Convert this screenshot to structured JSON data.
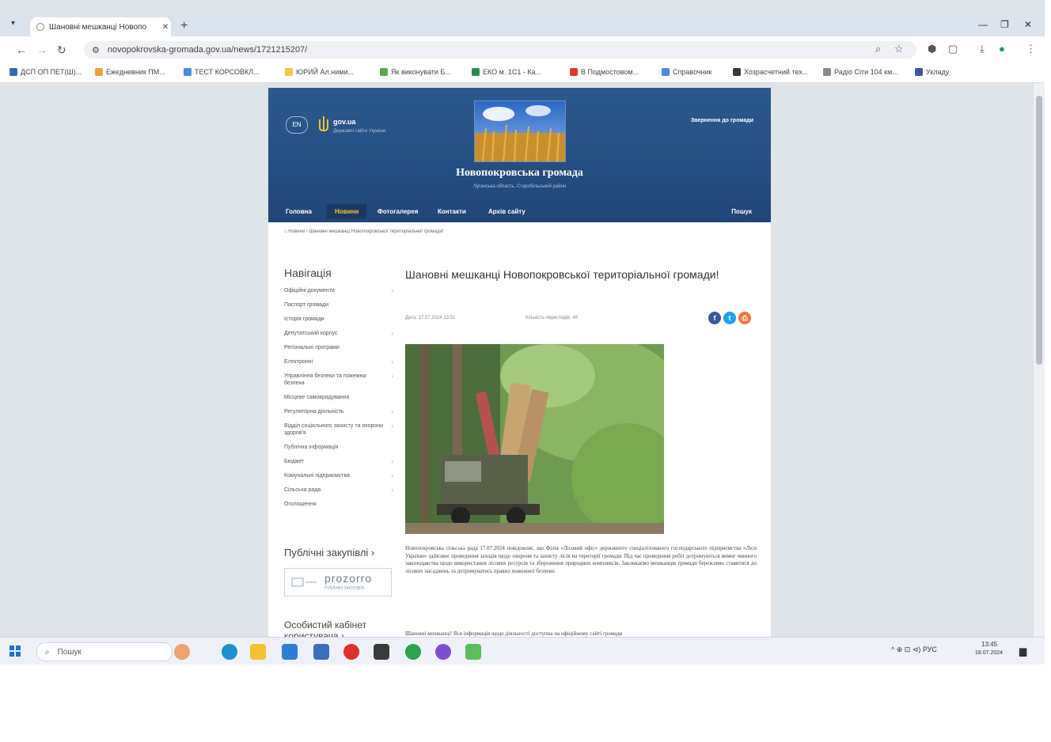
{
  "browser": {
    "tab_title": "Шановні мешканці Новопо",
    "tab_close": "✕",
    "new_tab": "+",
    "address": "novopokrovska-gromada.gov.ua/news/1721215207/",
    "window_min": "—",
    "window_max": "❐",
    "window_close": "✕"
  },
  "bookmarks": [
    {
      "label": "ДСП ОП ПЕТ(Ш)...",
      "color": "#2f6db5"
    },
    {
      "label": "Ежедневник ПМ...",
      "color": "#e8a33a"
    },
    {
      "label": "ТЕСТ КОРСОВКЛ...",
      "color": "#4c8bd6"
    },
    {
      "label": "ЮРИЙ Ал.ними...",
      "color": "#f5c542"
    },
    {
      "label": "Як виконувати Б...",
      "color": "#5aa84a"
    },
    {
      "label": "ЕКО м. 1С1 - Ка...",
      "color": "#2d8a4f"
    },
    {
      "label": "В Подмостовом...",
      "color": "#d83b2f"
    },
    {
      "label": "Справочник",
      "color": "#4c8bd6"
    },
    {
      "label": "Хозрасчетний тех...",
      "color": "#3a3a3a"
    },
    {
      "label": "Радіо Сіти 104 км...",
      "color": "#888888"
    },
    {
      "label": "Укладу",
      "color": "#3b5998"
    }
  ],
  "site": {
    "lang": "EN",
    "gov_name": "gov.ua",
    "gov_sub": "Державні сайти України",
    "header_link": "Звернення до громади",
    "title": "Новопокровська громада",
    "subtitle": "Луганська область, Старобільський район",
    "menu": [
      "Головна",
      "Новини",
      "Фотогалерея",
      "Контакти",
      "Архів сайту"
    ],
    "search_label": "Пошук",
    "breadcrumb": "⌂ Новини › Шановні мешканці Новопокровської територіальної громади!"
  },
  "sidebar": {
    "heading": "Навігація",
    "items": [
      {
        "label": "Офіційні документи",
        "chev": true
      },
      {
        "label": "Паспорт громади",
        "chev": false
      },
      {
        "label": "Історія громади",
        "chev": false
      },
      {
        "label": "Депутатський корпус",
        "chev": true
      },
      {
        "label": "Регіональні програми",
        "chev": false
      },
      {
        "label": "Електронні",
        "chev": true
      },
      {
        "label": "Управління безпеки та пожежна безпека",
        "chev": true
      },
      {
        "label": "Місцеве самоврядування",
        "chev": false
      },
      {
        "label": "Регуляторна діяльність",
        "chev": true
      },
      {
        "label": "Відділ соціального захисту та охорони здоров'я",
        "chev": true
      },
      {
        "label": "Публічна інформація",
        "chev": false
      },
      {
        "label": "Бюджет",
        "chev": true
      },
      {
        "label": "Комунальні підприємства",
        "chev": true
      },
      {
        "label": "Сільська рада",
        "chev": true
      },
      {
        "label": "Оголошення",
        "chev": false
      }
    ],
    "prozorro_heading": "Публічні закупівлі ›",
    "prozorro_logo": "prozorro",
    "prozorro_sub": "ПУБЛІЧНІ ЗАКУПІВЛІ",
    "cabinet": "Особистий кабінет користувача ›"
  },
  "article": {
    "title": "Шановні мешканці Новопокровської територіальної громади!",
    "date": "Дата: 17.07.2024 13:51",
    "views": "Кількість переглядів: 48",
    "body": "Новопокровська сільська рада 17.07.2024 повідомляє, що Філія «Лісовий офіс» державного спеціалізованого господарського підприємства «Ліси України» здійснює проведення заходів щодо охорони та захисту лісів на території громади. Під час проведення робіт дотримуються вимог чинного законодавства щодо використання лісових ресурсів та збереження природних комплексів. Закликаємо мешканців громади бережливо ставитися до лісових насаджень та дотримуватись правил пожежної безпеки.",
    "body2": "Шановні мешканці! Вся інформація щодо діяльності доступна на офіційному сайті громади"
  },
  "taskbar": {
    "search": "Пошук",
    "tray": "^ ⊕ ⊡ ⊲) РУС",
    "time": "13:45",
    "date": "18.07.2024"
  },
  "colors": {
    "header": "#2c5a8f",
    "accent": "#f2c230",
    "facebook": "#3b5998",
    "twitter": "#1da1f2",
    "print": "#f0743a"
  }
}
